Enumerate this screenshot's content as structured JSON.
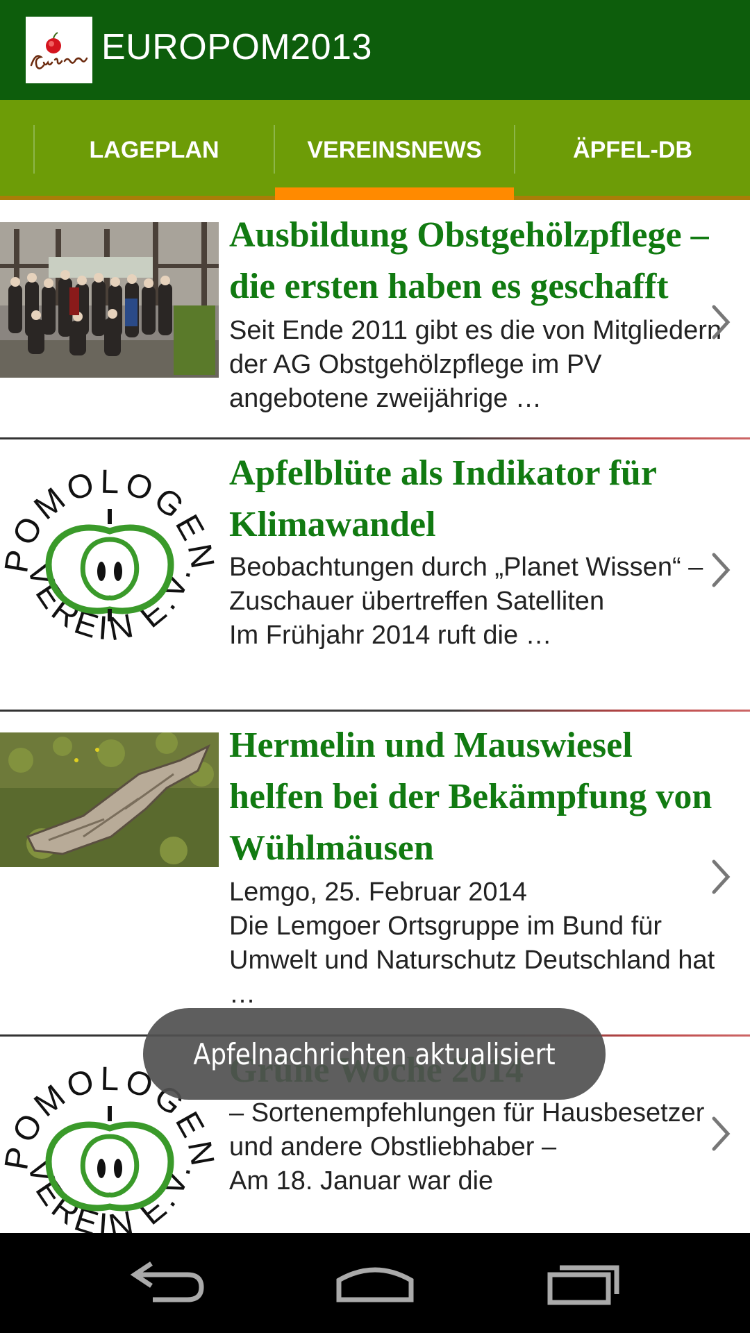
{
  "app": {
    "title": "EUROPOM2013",
    "logo_text": "Europom",
    "logo_icon": "apple-logo-icon"
  },
  "tabs": [
    {
      "label": "LAGEPLAN",
      "selected": false
    },
    {
      "label": "VEREINSNEWS",
      "selected": true
    },
    {
      "label": "ÄPFEL-DB",
      "selected": false
    }
  ],
  "colors": {
    "action_bar": "#0d5d0c",
    "tab_bar": "#6d9c07",
    "tab_indicator": "#ff8a00",
    "title_green": "#117a11",
    "toast_bg": "#505050"
  },
  "news": [
    {
      "title": "Ausbildung Obstgehölzpflege – die ersten haben es geschafft",
      "text": "Seit Ende 2011 gibt es die von Mitgliedern der AG Obstgehölzpflege im PV angebotene zweijährige …",
      "thumb": "group-photo"
    },
    {
      "title": "Apfelblüte als Indikator für Klimawandel",
      "text": "Beobachtungen durch „Planet Wissen“ – Zuschauer übertreffen Satelliten\nIm Frühjahr 2014 ruft die …",
      "thumb": "pomologen-logo"
    },
    {
      "title": "Hermelin und Mauswiesel helfen bei der Bekämpfung von Wühlmäusen",
      "text": "Lemgo, 25. Februar 2014\nDie Lemgoer Ortsgruppe im Bund für Umwelt und Naturschutz Deutschland hat …",
      "thumb": "tree-stump-photo"
    },
    {
      "title": "Grüne Woche 2014",
      "text": "– Sortenempfehlungen für Hausbesetzer und andere Obstliebhaber –\nAm 18. Januar war die",
      "thumb": "pomologen-logo"
    }
  ],
  "pomologen_logo": {
    "top_text": "POMOLOGEN",
    "bottom_text": "VEREIN E.V."
  },
  "toast": {
    "text": "Apfelnachrichten aktualisiert"
  },
  "navbar": {
    "back": "back-icon",
    "home": "home-icon",
    "recents": "recents-icon"
  }
}
